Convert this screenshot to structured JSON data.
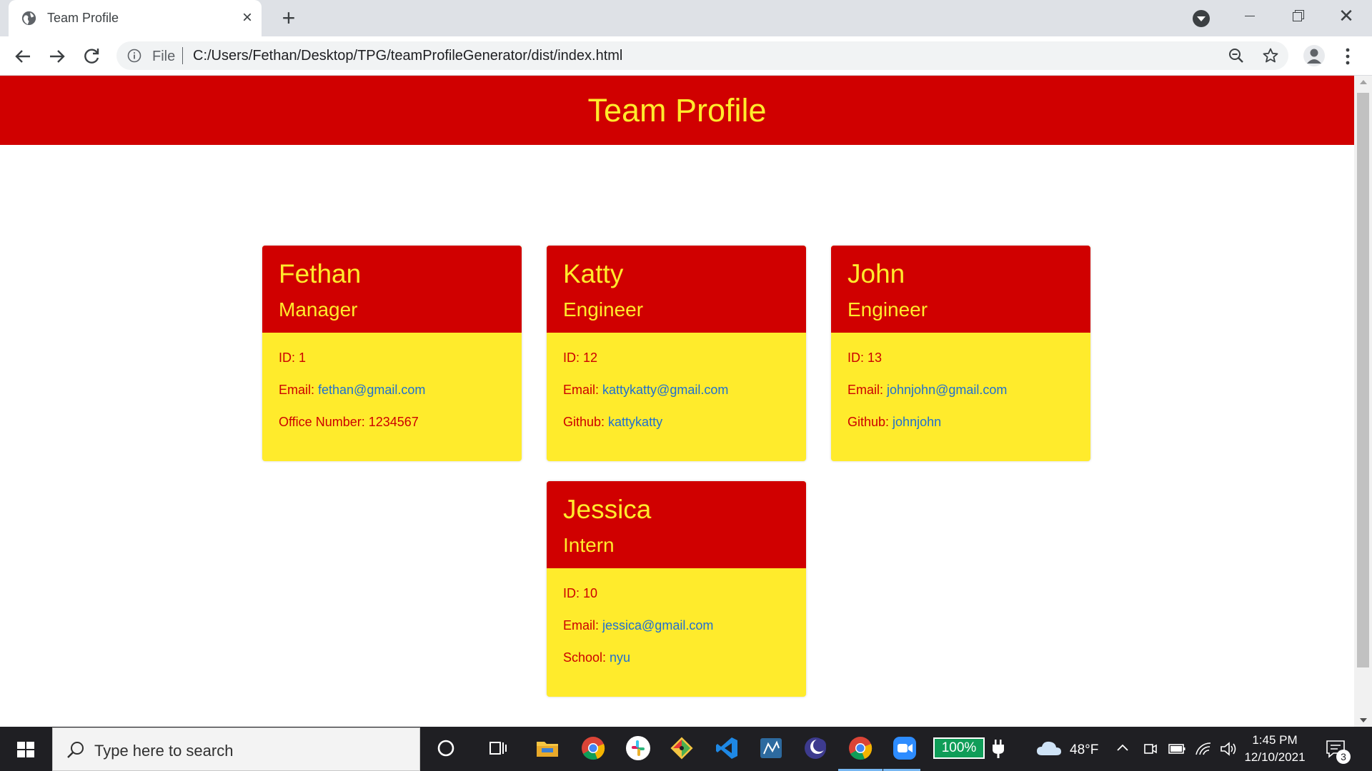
{
  "browser": {
    "tab_title": "Team Profile",
    "tab_close": "×",
    "new_tab": "+",
    "scheme": "File",
    "url": "C:/Users/Fethan/Desktop/TPG/teamProfileGenerator/dist/index.html",
    "window_close": "✕"
  },
  "page": {
    "title": "Team Profile",
    "cards": [
      {
        "name": "Fethan",
        "role": "Manager",
        "id_label": "ID: ",
        "id": "1",
        "email_label": "Email: ",
        "email": "fethan@gmail.com",
        "extra_label": "Office Number: ",
        "extra": "1234567"
      },
      {
        "name": "Katty",
        "role": "Engineer",
        "id_label": "ID: ",
        "id": "12",
        "email_label": "Email: ",
        "email": "kattykatty@gmail.com",
        "extra_label": "Github: ",
        "extra": "kattykatty"
      },
      {
        "name": "John",
        "role": "Engineer",
        "id_label": "ID: ",
        "id": "13",
        "email_label": "Email: ",
        "email": "johnjohn@gmail.com",
        "extra_label": "Github: ",
        "extra": "johnjohn"
      },
      {
        "name": "Jessica",
        "role": "Intern",
        "id_label": "ID: ",
        "id": "10",
        "email_label": "Email: ",
        "email": "jessica@gmail.com",
        "extra_label": "School: ",
        "extra": "nyu"
      }
    ]
  },
  "taskbar": {
    "search_placeholder": "Type here to search",
    "battery": "100%",
    "temperature": "48°F",
    "time": "1:45 PM",
    "date": "12/10/2021",
    "notification_count": "3",
    "icons": [
      "cortana-icon",
      "task-view-icon",
      "file-explorer-icon",
      "chrome-icon",
      "slack-icon",
      "git-icon",
      "vscode-icon",
      "mysql-workbench-icon",
      "eclipse-icon",
      "chrome-active-icon",
      "zoom-icon"
    ]
  },
  "colors": {
    "header_red": "#d00000",
    "card_yellow": "#ffeb2c",
    "title_yellow": "#ffeb2c",
    "label_red": "#cc0000",
    "link_blue": "#1f6fd1"
  }
}
